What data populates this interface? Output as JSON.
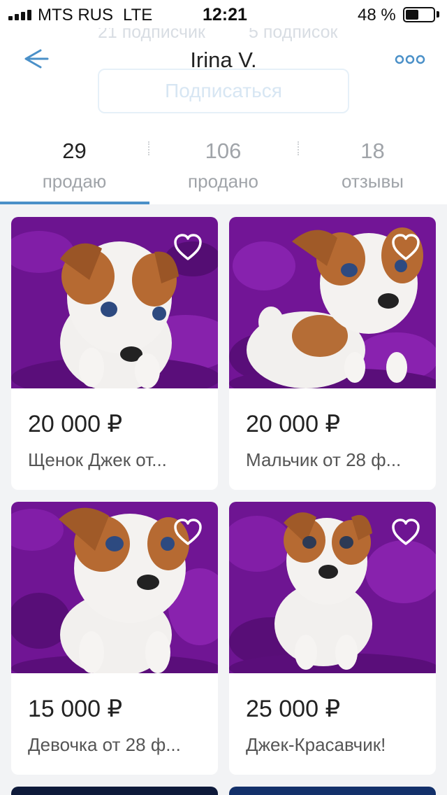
{
  "status_bar": {
    "carrier": "MTS RUS",
    "network": "LTE",
    "time": "12:21",
    "battery": "48 %",
    "battery_level": 0.48,
    "signal_bars": 4
  },
  "profile": {
    "followers_ghost": "21 подписчик",
    "following_ghost": "5 подписок",
    "name": "Irina V.",
    "subscribe_label": "Подписаться"
  },
  "icons": {
    "back": "arrow-left-icon",
    "more": "more-dots-icon",
    "favorite": "heart-outline-icon"
  },
  "colors": {
    "accent": "#4a90c8",
    "purple_bg": "#7b1a9a"
  },
  "tabs": [
    {
      "count": "29",
      "label": "продаю",
      "active": true
    },
    {
      "count": "106",
      "label": "продано",
      "active": false
    },
    {
      "count": "18",
      "label": "отзывы",
      "active": false
    }
  ],
  "listings": [
    {
      "price": "20 000 ₽",
      "title": "Щенок Джек от..."
    },
    {
      "price": "20 000 ₽",
      "title": "Мальчик от 28 ф..."
    },
    {
      "price": "15 000 ₽",
      "title": "Девочка от 28 ф..."
    },
    {
      "price": "25 000 ₽",
      "title": "Джек-Красавчик!"
    }
  ]
}
